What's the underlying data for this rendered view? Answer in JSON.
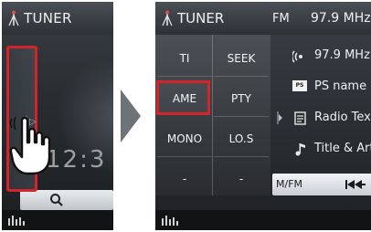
{
  "left_screen": {
    "title": "TUNER",
    "clock_partial": "12:3"
  },
  "right_screen": {
    "title": "TUNER",
    "band": "FM",
    "frequency": "97.9 MHz",
    "menu": [
      {
        "label": "TI"
      },
      {
        "label": "SEEK"
      },
      {
        "label": "AME",
        "highlighted": true
      },
      {
        "label": "PTY"
      },
      {
        "label": "MONO"
      },
      {
        "label": "LO.S"
      },
      {
        "label": "-"
      },
      {
        "label": "-"
      }
    ],
    "info": [
      {
        "icon": "radio-wave-icon",
        "text": "97.9 MHz"
      },
      {
        "icon": "ps-badge-icon",
        "badge": "PS",
        "text": "PS name"
      },
      {
        "icon": "radio-text-icon",
        "text": "Radio Text"
      },
      {
        "icon": "music-note-icon",
        "text": "Title & Artist"
      }
    ],
    "control": {
      "mode_label": "M/FM"
    }
  },
  "colors": {
    "highlight": "#d3242b",
    "arrow": "#6e7378"
  }
}
